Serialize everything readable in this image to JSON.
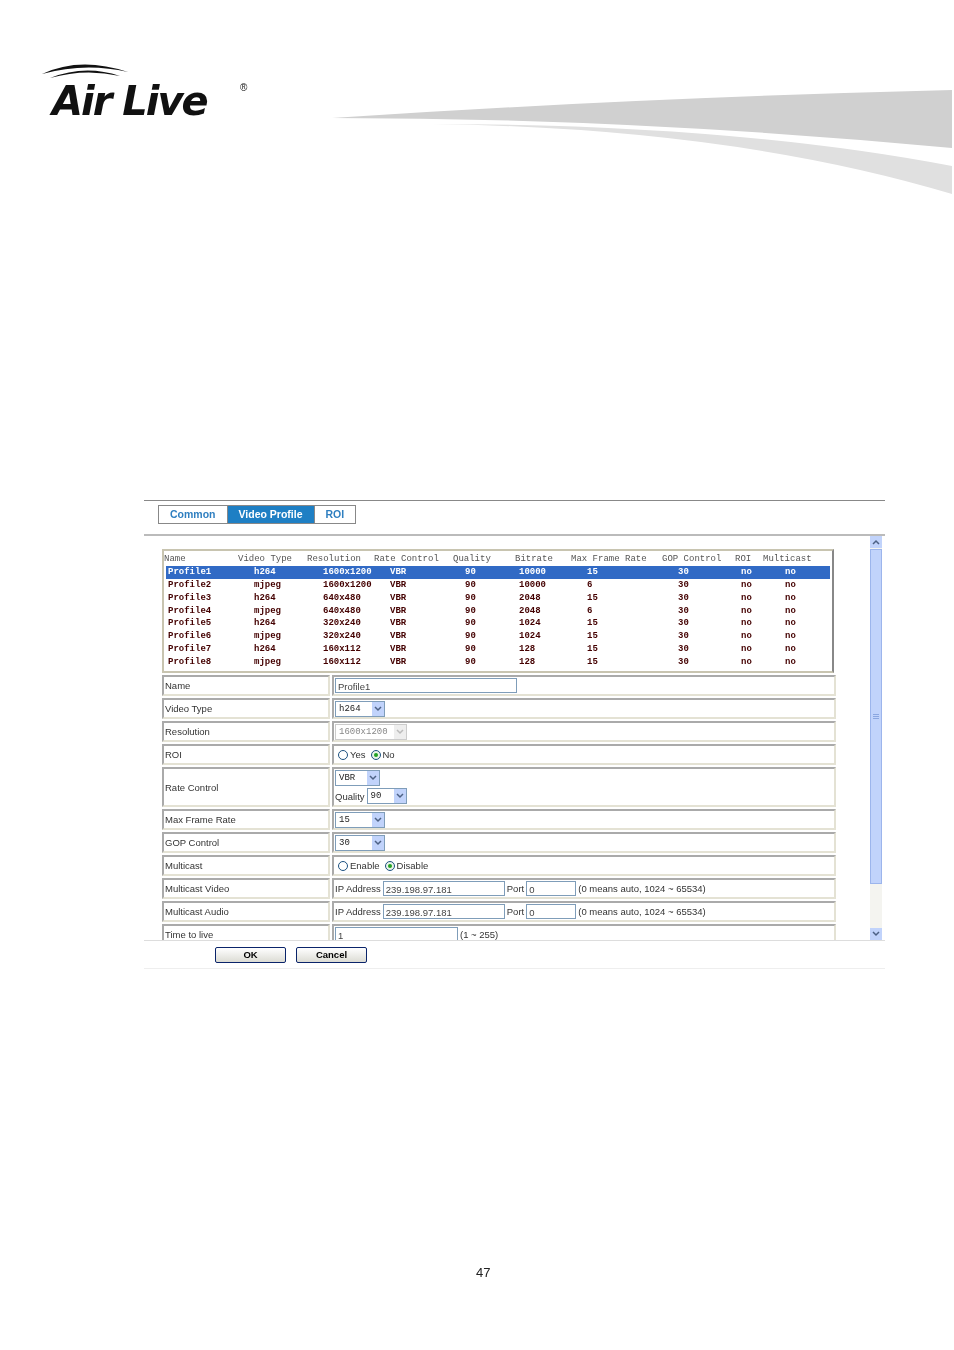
{
  "logo": {
    "text": "Air Live",
    "mark": "®"
  },
  "tabs": [
    {
      "label": "Common",
      "selected": false
    },
    {
      "label": "Video Profile",
      "selected": true
    },
    {
      "label": "ROI",
      "selected": false
    }
  ],
  "profiles": {
    "columns": [
      "Name",
      "Video Type",
      "Resolution",
      "Rate Control",
      "Quality",
      "Bitrate",
      "Max Frame Rate",
      "GOP Control",
      "ROI",
      "Multicast"
    ],
    "rows": [
      {
        "cells": [
          "Profile1",
          "h264",
          "1600x1200",
          "VBR",
          "90",
          "10000",
          "15",
          "30",
          "no",
          "no"
        ],
        "selected": true
      },
      {
        "cells": [
          "Profile2",
          "mjpeg",
          "1600x1200",
          "VBR",
          "90",
          "10000",
          "6",
          "30",
          "no",
          "no"
        ],
        "selected": false
      },
      {
        "cells": [
          "Profile3",
          "h264",
          "640x480",
          "VBR",
          "90",
          "2048",
          "15",
          "30",
          "no",
          "no"
        ],
        "selected": false
      },
      {
        "cells": [
          "Profile4",
          "mjpeg",
          "640x480",
          "VBR",
          "90",
          "2048",
          "6",
          "30",
          "no",
          "no"
        ],
        "selected": false
      },
      {
        "cells": [
          "Profile5",
          "h264",
          "320x240",
          "VBR",
          "90",
          "1024",
          "15",
          "30",
          "no",
          "no"
        ],
        "selected": false
      },
      {
        "cells": [
          "Profile6",
          "mjpeg",
          "320x240",
          "VBR",
          "90",
          "1024",
          "15",
          "30",
          "no",
          "no"
        ],
        "selected": false
      },
      {
        "cells": [
          "Profile7",
          "h264",
          "160x112",
          "VBR",
          "90",
          "128",
          "15",
          "30",
          "no",
          "no"
        ],
        "selected": false
      },
      {
        "cells": [
          "Profile8",
          "mjpeg",
          "160x112",
          "VBR",
          "90",
          "128",
          "15",
          "30",
          "no",
          "no"
        ],
        "selected": false
      }
    ]
  },
  "form": [
    {
      "kind": "text",
      "label": "Name",
      "value": "Profile1"
    },
    {
      "kind": "select",
      "label": "Video Type",
      "value": "h264",
      "disabled": false
    },
    {
      "kind": "select",
      "label": "Resolution",
      "value": "1600x1200",
      "disabled": true
    },
    {
      "kind": "radio",
      "label": "ROI",
      "options": [
        {
          "label": "Yes",
          "selected": false
        },
        {
          "label": "No",
          "selected": true
        }
      ]
    },
    {
      "kind": "rate",
      "label": "Rate Control",
      "value": "VBR",
      "quality_label": "Quality",
      "quality": "90"
    },
    {
      "kind": "select",
      "label": "Max Frame Rate",
      "value": "15",
      "disabled": false
    },
    {
      "kind": "select",
      "label": "GOP Control",
      "value": "30",
      "disabled": false
    },
    {
      "kind": "radio",
      "label": "Multicast",
      "options": [
        {
          "label": "Enable",
          "selected": false
        },
        {
          "label": "Disable",
          "selected": true
        }
      ]
    },
    {
      "kind": "address",
      "label": "Multicast Video",
      "ip_label": "IP Address",
      "ip": "239.198.97.181",
      "port_label": "Port",
      "port": "0",
      "hint": "(0 means auto, 1024 ~ 65534)"
    },
    {
      "kind": "address",
      "label": "Multicast Audio",
      "ip_label": "IP Address",
      "ip": "239.198.97.181",
      "port_label": "Port",
      "port": "0",
      "hint": "(0 means auto, 1024 ~ 65534)"
    },
    {
      "kind": "ttl",
      "label": "Time to live",
      "value": "1",
      "hint": "(1 ~ 255)"
    }
  ],
  "buttons": [
    "OK",
    "Cancel"
  ],
  "page_number": "47"
}
